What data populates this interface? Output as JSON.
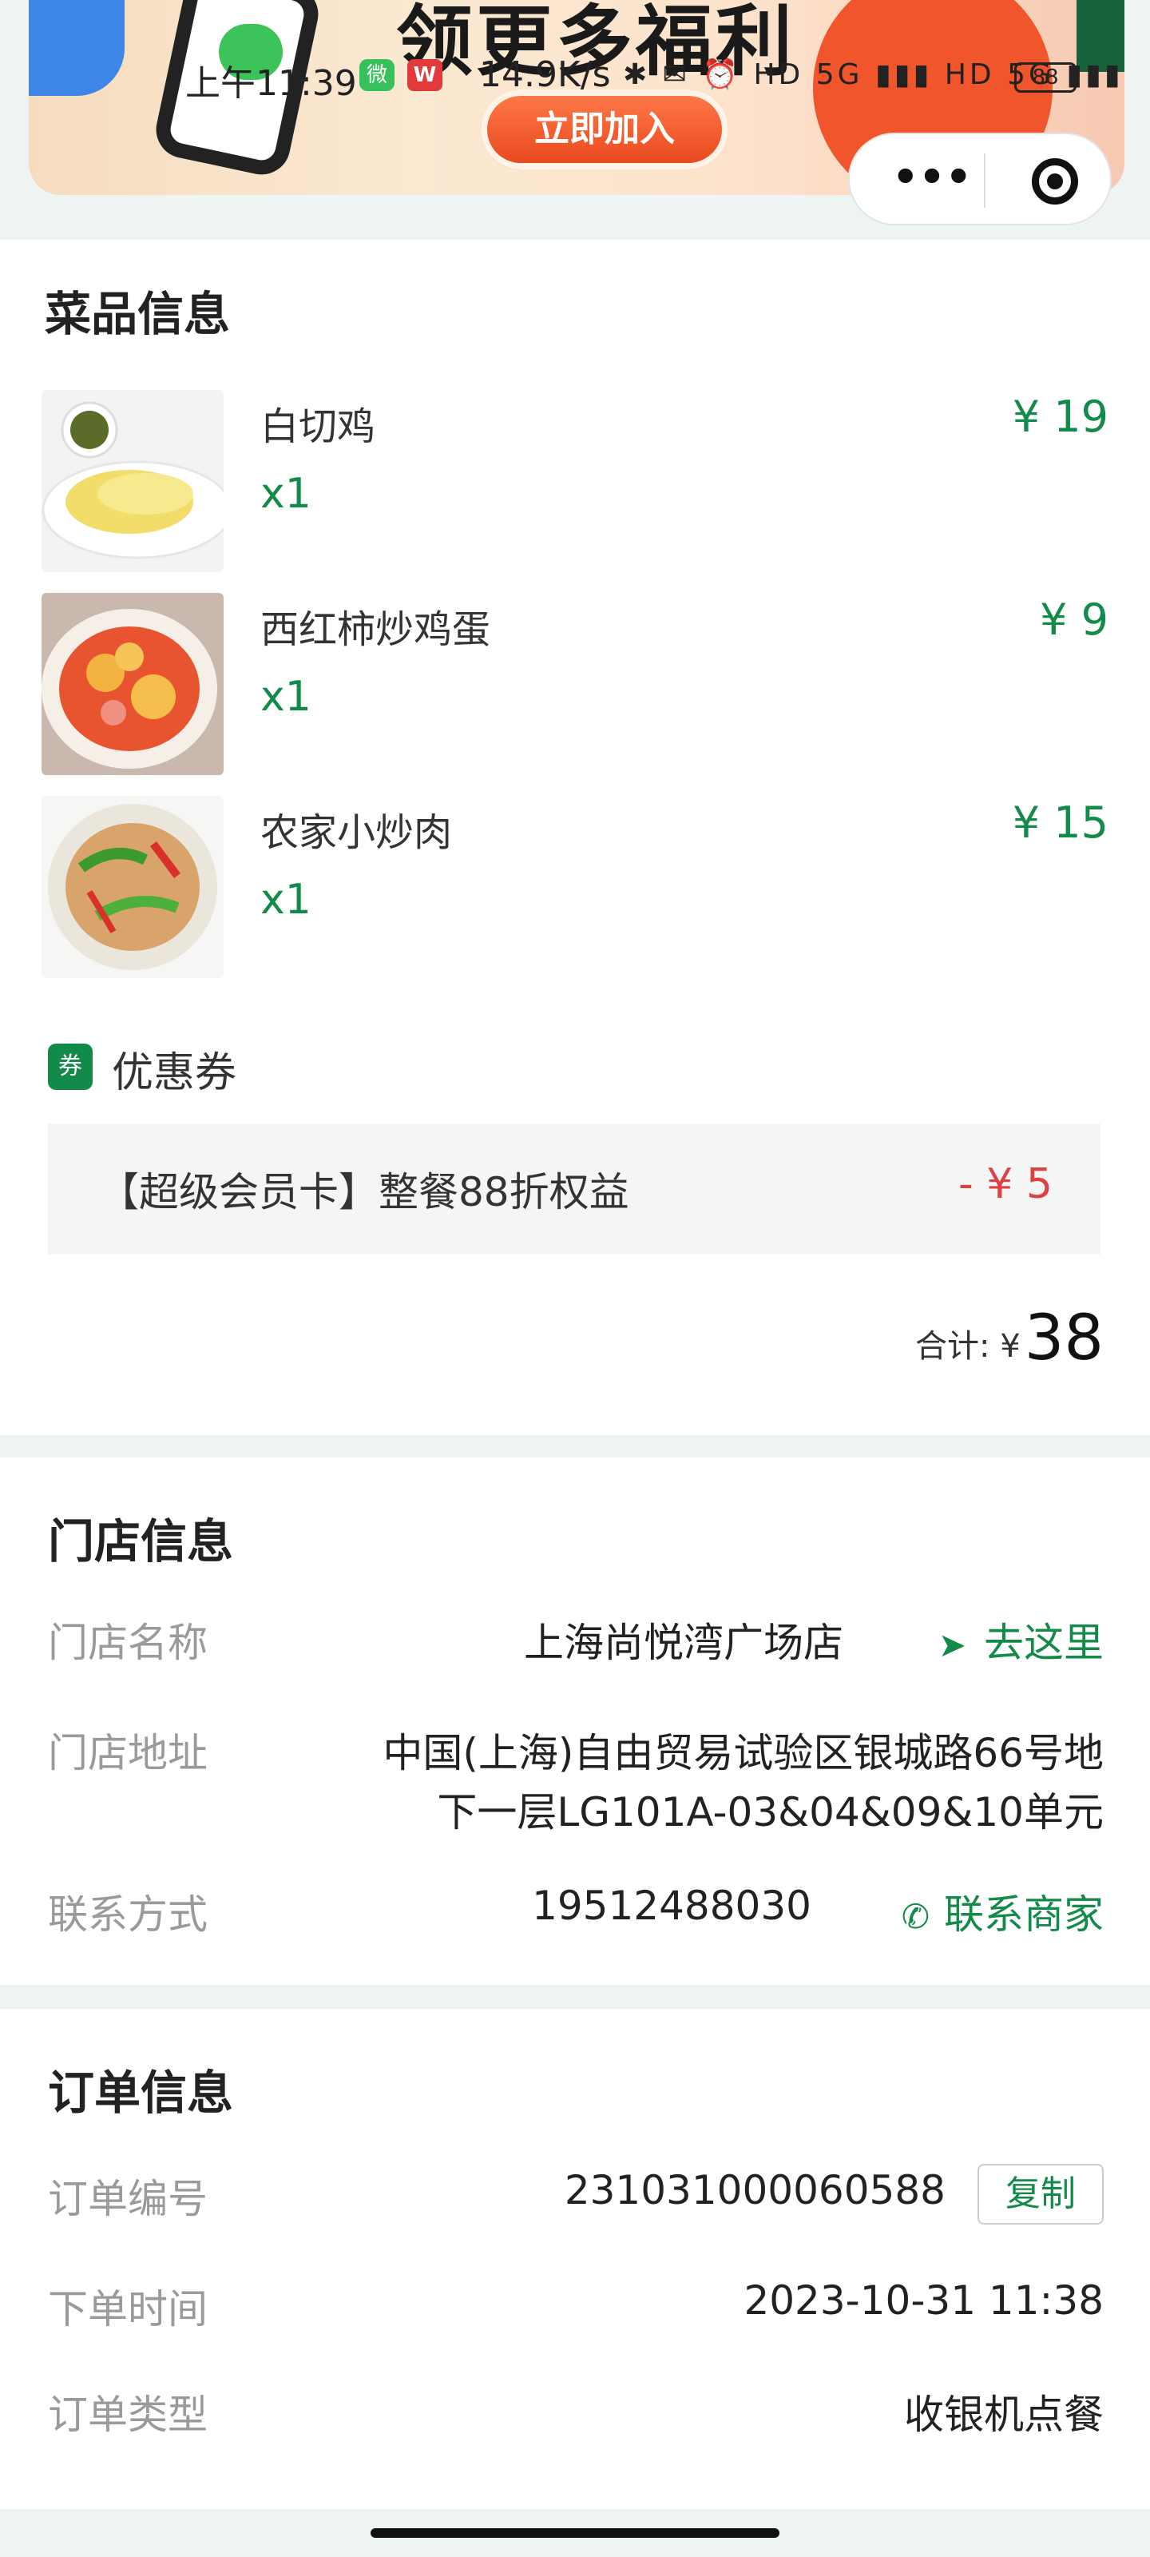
{
  "banner": {
    "headline": "领更多福利",
    "cta": "立即加入"
  },
  "status_bar": {
    "time": "上午11:39",
    "speed": "14.9K/s",
    "icons": "✱ ✉ ⏰ HD 5G ▮▮▮ HD 5G ▮▮▮",
    "battery": "88",
    "wechat": "微",
    "wps": "W"
  },
  "capsule": {
    "more": "•••"
  },
  "dishes_section": {
    "title": "菜品信息",
    "items": [
      {
        "name": "白切鸡",
        "qty": "x1",
        "price": "¥ 19"
      },
      {
        "name": "西红柿炒鸡蛋",
        "qty": "x1",
        "price": "¥ 9"
      },
      {
        "name": "农家小炒肉",
        "qty": "x1",
        "price": "¥ 15"
      }
    ],
    "coupon": {
      "badge": "券",
      "title": "优惠券",
      "text": "【超级会员卡】整餐88折权益",
      "amount": "- ¥ 5"
    },
    "total_label": "合计: ¥",
    "total_value": "38"
  },
  "store_section": {
    "title": "门店信息",
    "name_label": "门店名称",
    "name_value": "上海尚悦湾广场店",
    "go_here": "去这里",
    "address_label": "门店地址",
    "address_line1": "中国(上海)自由贸易试验区银城路66号地",
    "address_line2": "下一层LG101A-03&04&09&10单元",
    "contact_label": "联系方式",
    "contact_value": "19512488030",
    "contact_merchant": "联系商家"
  },
  "order_section": {
    "title": "订单信息",
    "number_label": "订单编号",
    "number_value": "231031000060588",
    "copy": "复制",
    "time_label": "下单时间",
    "time_value": "2023-10-31 11:38",
    "type_label": "订单类型",
    "type_value": "收银机点餐"
  },
  "colors": {
    "accent": "#128a49",
    "discount": "#e04040",
    "page_bg": "#eef4f3"
  }
}
